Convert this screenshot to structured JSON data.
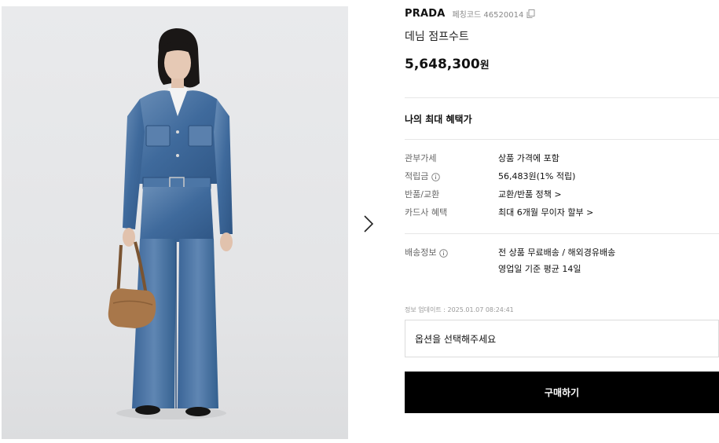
{
  "product": {
    "brand": "PRADA",
    "code_label": "페칭코드 46520014",
    "title": "데님 점프수트",
    "price": "5,648,300",
    "currency": "원",
    "image_alt": "woman wearing denim jumpsuit with brown handbag"
  },
  "benefits": {
    "title": "나의 최대 혜택가",
    "rows": [
      {
        "label": "관부가세",
        "value": "상품 가격에 포함"
      },
      {
        "label": "적립금",
        "value": "56,483원(1% 적립)"
      },
      {
        "label": "반품/교환",
        "value": "교환/반품 정책 >"
      },
      {
        "label": "카드사 혜택",
        "value": "최대 6개월 무이자 할부 >"
      }
    ]
  },
  "shipping": {
    "label": "배송정보",
    "line1": "전 상품 무료배송 / 해외경유배송",
    "line2": "영업일 기준 평균 14일"
  },
  "updated": "정보 업데이트 : 2025.01.07 08:24:41",
  "option_placeholder": "옵션을 선택해주세요",
  "buy_label": "구매하기",
  "colors": {
    "denim": "#3f6a9c",
    "bag": "#a8774a",
    "button": "#000000"
  },
  "icons": [
    "copy-icon",
    "info-icon",
    "chevron-right-icon"
  ]
}
